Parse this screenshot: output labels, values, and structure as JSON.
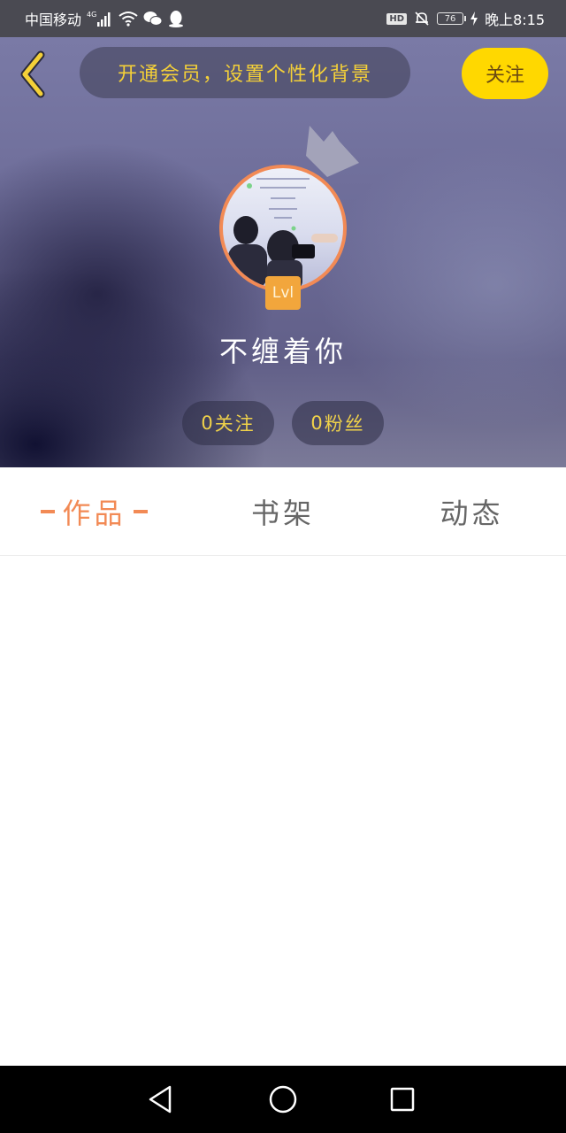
{
  "status_bar": {
    "carrier": "中国移动",
    "network": "4G",
    "battery": "76",
    "time": "晚上8:15",
    "hd_label": "HD",
    "icons": [
      "signal-icon",
      "wifi-icon",
      "wechat-icon",
      "qq-icon",
      "mute-bell-icon",
      "charging-icon"
    ]
  },
  "header": {
    "vip_banner": "开通会员，设置个性化背景",
    "follow_label": "关注",
    "username": "不缠着你",
    "level": "Lvl",
    "following_count": "0",
    "following_label": "关注",
    "fans_count": "0",
    "fans_label": "粉丝"
  },
  "tabs": [
    {
      "label": "作品",
      "active": true
    },
    {
      "label": "书架",
      "active": false
    },
    {
      "label": "动态",
      "active": false
    }
  ],
  "nav_bar": {
    "icons": [
      "back-triangle-icon",
      "home-circle-icon",
      "recent-square-icon"
    ]
  },
  "colors": {
    "accent_orange": "#f28a55",
    "follow_yellow": "#ffd800",
    "banner_text": "#f4d038",
    "status_bar_bg": "#4a4a52"
  }
}
